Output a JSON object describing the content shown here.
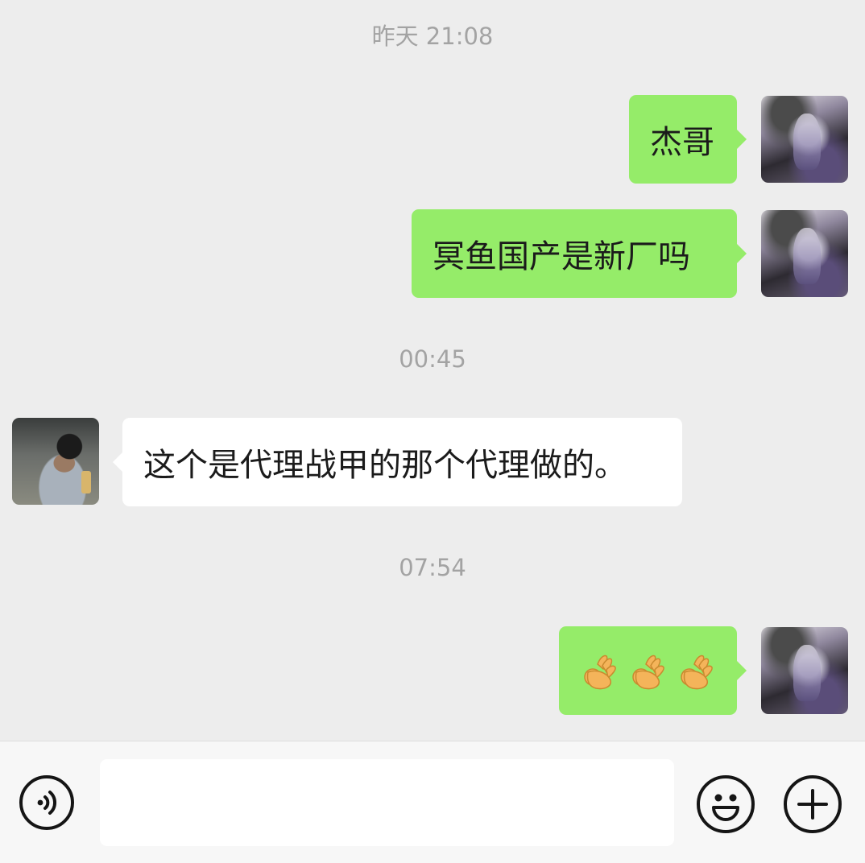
{
  "chat": {
    "timestamps": [
      "昨天 21:08",
      "00:45",
      "07:54"
    ],
    "messages": [
      {
        "text": "杰哥"
      },
      {
        "text": "冥鱼国产是新厂吗"
      },
      {
        "text": "这个是代理战甲的那个代理做的。"
      },
      {
        "emoji": "ok-hand",
        "count": 3
      }
    ]
  },
  "input": {
    "value": "",
    "placeholder": ""
  },
  "colors": {
    "background": "#ededed",
    "sent_bubble": "#95ec69",
    "received_bubble": "#ffffff",
    "timestamp_text": "#a3a3a3"
  },
  "icons": {
    "voice": "voice-icon",
    "emoji": "emoji-icon",
    "more": "plus-icon"
  }
}
